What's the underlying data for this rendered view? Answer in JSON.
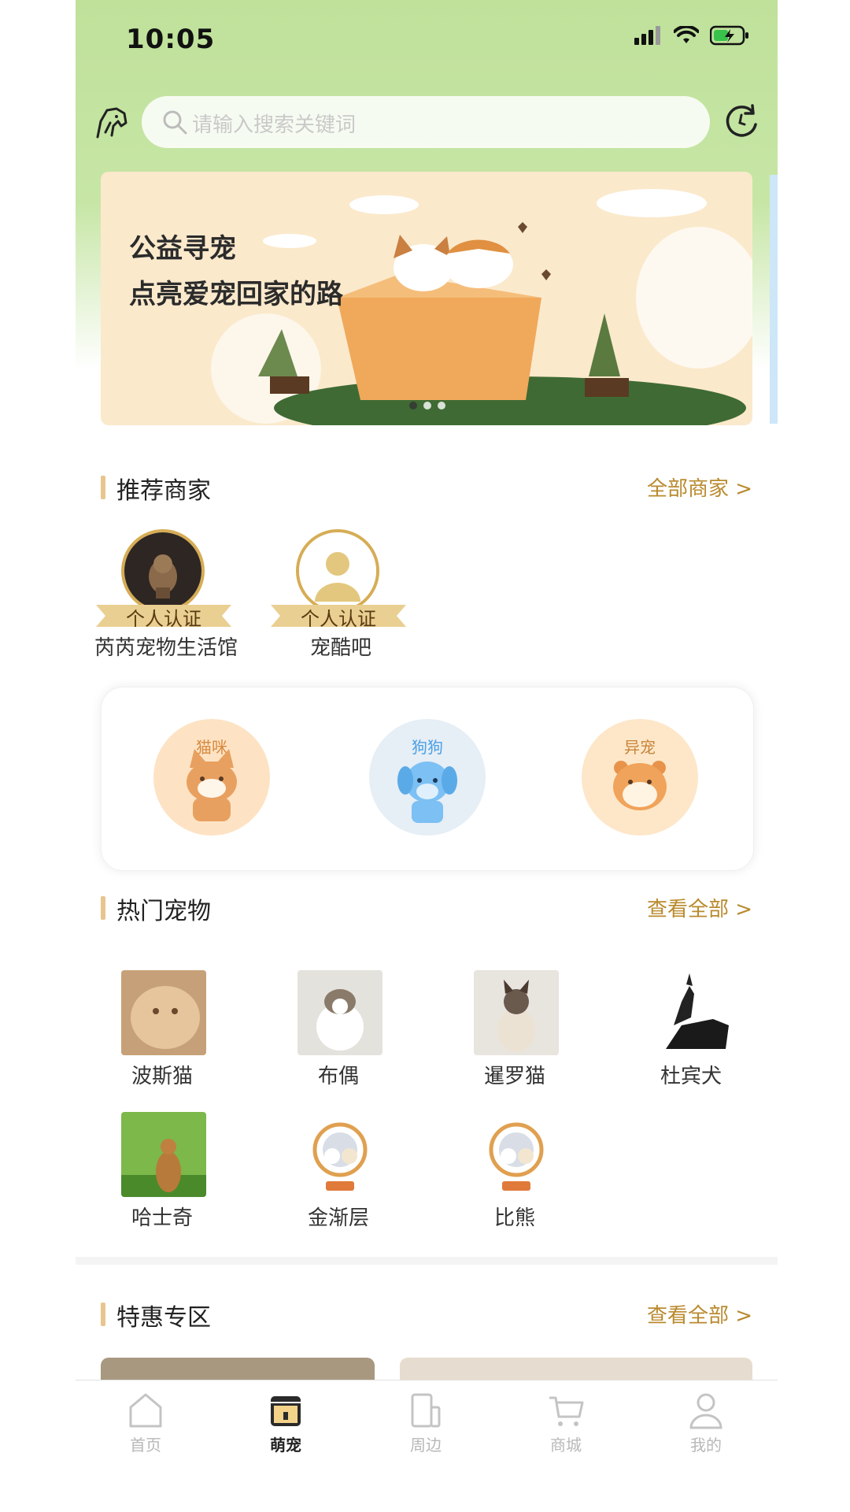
{
  "status": {
    "time": "10:05"
  },
  "search": {
    "placeholder": "请输入搜索关键词"
  },
  "banner": {
    "line1": "公益寻宠",
    "line2": "点亮爱宠回家的路"
  },
  "sections": {
    "merchants": {
      "title": "推荐商家",
      "more": "全部商家 >"
    },
    "hot_pets": {
      "title": "热门宠物",
      "more": "查看全部 >"
    },
    "deals": {
      "title": "特惠专区",
      "more": "查看全部 >"
    }
  },
  "merchants": [
    {
      "badge": "个人认证",
      "name": "芮芮宠物生活馆"
    },
    {
      "badge": "个人认证",
      "name": "宠酷吧"
    }
  ],
  "categories": [
    {
      "label": "猫咪",
      "icon": "cat-icon",
      "color": "#fde3c4"
    },
    {
      "label": "狗狗",
      "icon": "dog-icon",
      "color": "#e6eef6"
    },
    {
      "label": "异宠",
      "icon": "hamster-icon",
      "color": "#fde7c8"
    }
  ],
  "pets": [
    {
      "name": "波斯猫"
    },
    {
      "name": "布偶"
    },
    {
      "name": "暹罗猫"
    },
    {
      "name": "杜宾犬"
    },
    {
      "name": "哈士奇"
    },
    {
      "name": "金渐层"
    },
    {
      "name": "比熊"
    }
  ],
  "tabs": [
    {
      "label": "首页",
      "icon": "home-icon",
      "active": false
    },
    {
      "label": "萌宠",
      "icon": "pet-shop-icon",
      "active": true
    },
    {
      "label": "周边",
      "icon": "nearby-icon",
      "active": false
    },
    {
      "label": "商城",
      "icon": "cart-icon",
      "active": false
    },
    {
      "label": "我的",
      "icon": "user-icon",
      "active": false
    }
  ],
  "colors": {
    "accent": "#b98a2e",
    "header_green": "#c7e6a6",
    "badge_gold": "#d6ad55"
  }
}
